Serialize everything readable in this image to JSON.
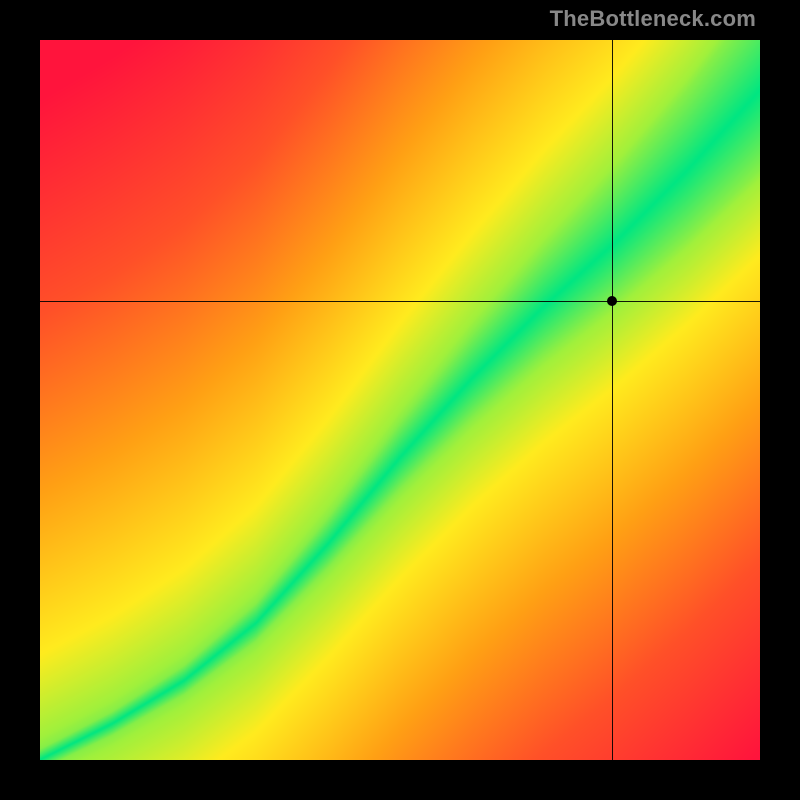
{
  "attribution": "TheBottleneck.com",
  "chart_data": {
    "type": "heatmap",
    "title": "",
    "xlabel": "",
    "ylabel": "",
    "xlim": [
      0,
      1
    ],
    "ylim": [
      0,
      1
    ],
    "colorscale_note": "green = no bottleneck (balanced), red = severe bottleneck; diagonal green band follows optimal CPU/GPU pairing curve",
    "marker": {
      "x": 0.795,
      "y": 0.638,
      "note": "selected configuration point near green band"
    },
    "curve_points": [
      {
        "x": 0.0,
        "y": 0.0
      },
      {
        "x": 0.1,
        "y": 0.05
      },
      {
        "x": 0.2,
        "y": 0.11
      },
      {
        "x": 0.3,
        "y": 0.19
      },
      {
        "x": 0.4,
        "y": 0.3
      },
      {
        "x": 0.5,
        "y": 0.42
      },
      {
        "x": 0.6,
        "y": 0.53
      },
      {
        "x": 0.7,
        "y": 0.63
      },
      {
        "x": 0.8,
        "y": 0.72
      },
      {
        "x": 0.9,
        "y": 0.82
      },
      {
        "x": 1.0,
        "y": 0.93
      }
    ],
    "band_halfwidth_fraction": 0.05
  }
}
